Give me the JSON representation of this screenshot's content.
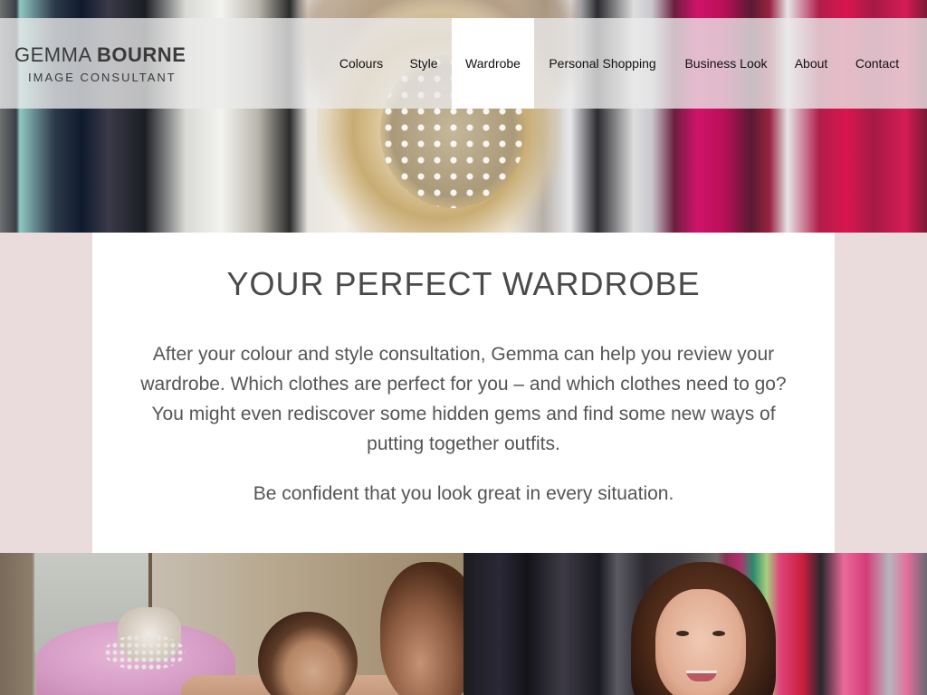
{
  "logo": {
    "name_first": "GEMMA",
    "name_last": "BOURNE",
    "tagline": "IMAGE CONSULTANT"
  },
  "nav": {
    "items": [
      {
        "label": "Colours",
        "active": false
      },
      {
        "label": "Style",
        "active": false
      },
      {
        "label": "Wardrobe",
        "active": true
      },
      {
        "label": "Personal Shopping",
        "active": false
      },
      {
        "label": "Business Look",
        "active": false
      },
      {
        "label": "About",
        "active": false
      },
      {
        "label": "Contact",
        "active": false
      }
    ]
  },
  "main": {
    "title": "YOUR PERFECT WARDROBE",
    "intro": "After your colour and style consultation, Gemma can help you review your wardrobe. Which clothes are perfect for you – and which clothes need to go? You might even rediscover some hidden gems and find some new ways of putting together outfits.",
    "tagline": "Be confident that you look great in every situation."
  },
  "colors": {
    "page_background": "#eadcdc",
    "navbar_background": "rgba(235,235,235,0.78)",
    "active_nav_background": "#ffffff",
    "text_primary": "#555555"
  }
}
